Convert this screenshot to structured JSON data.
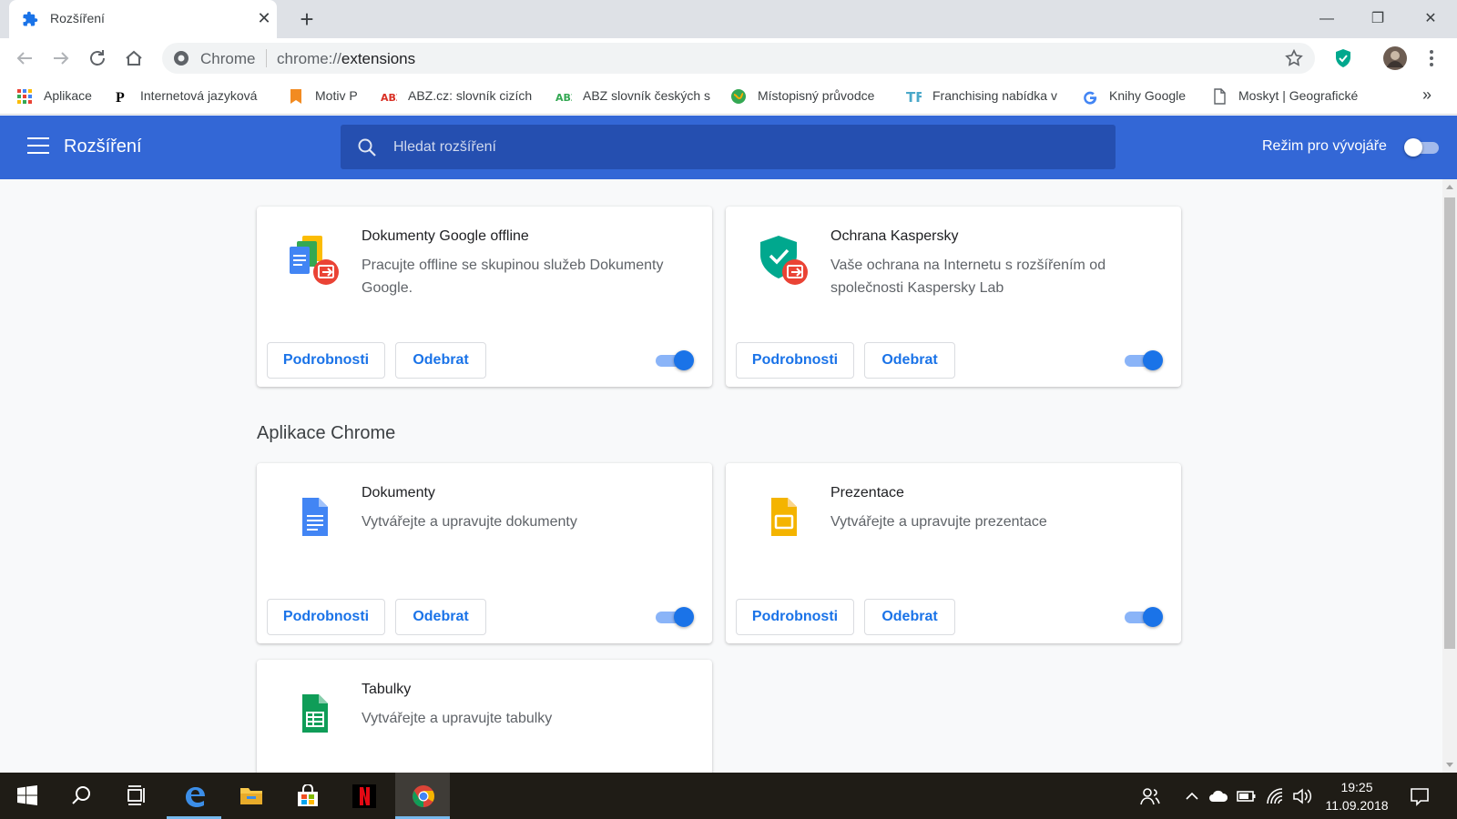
{
  "browser": {
    "tab_title": "Rozšíření",
    "new_tab_symbol": "+",
    "close_symbol": "✕",
    "window_controls": {
      "minimize": "—",
      "restore": "❐",
      "close": "✕"
    }
  },
  "omnibox": {
    "site_chip": "Chrome",
    "url_scheme": "chrome://",
    "url_host": "extensions"
  },
  "bookmarks": {
    "items": [
      {
        "label": "Aplikace",
        "icon": "apps-grid-icon"
      },
      {
        "label": "Internetová jazyková",
        "icon": "p-letter-icon"
      },
      {
        "label": "Motiv P",
        "icon": "bookmark-icon"
      },
      {
        "label": "ABZ.cz: slovník cizích",
        "icon": "abz-icon"
      },
      {
        "label": "ABZ slovník českých s",
        "icon": "abz-green-icon"
      },
      {
        "label": "Místopisný průvodce",
        "icon": "globe-icon"
      },
      {
        "label": "Franchising nabídka v",
        "icon": "tf-icon"
      },
      {
        "label": "Knihy Google",
        "icon": "google-g-icon"
      },
      {
        "label": "Moskyt | Geografické",
        "icon": "page-icon"
      }
    ],
    "more": "»"
  },
  "header": {
    "title": "Rozšíření",
    "search_placeholder": "Hledat rozšíření",
    "dev_mode_label": "Režim pro vývojáře"
  },
  "section_title": "Aplikace Chrome",
  "cards": [
    {
      "name": "Dokumenty Google offline",
      "description": "Pracujte offline se skupinou služeb Dokumenty Google.",
      "details": "Podrobnosti",
      "remove": "Odebrat"
    },
    {
      "name": "Ochrana Kaspersky",
      "description": "Vaše ochrana na Internetu s rozšířením od společnosti Kaspersky Lab",
      "details": "Podrobnosti",
      "remove": "Odebrat"
    },
    {
      "name": "Dokumenty",
      "description": "Vytvářejte a upravujte dokumenty",
      "details": "Podrobnosti",
      "remove": "Odebrat"
    },
    {
      "name": "Prezentace",
      "description": "Vytvářejte a upravujte prezentace",
      "details": "Podrobnosti",
      "remove": "Odebrat"
    },
    {
      "name": "Tabulky",
      "description": "Vytvářejte a upravujte tabulky"
    }
  ],
  "taskbar": {
    "time": "19:25",
    "date": "11.09.2018"
  },
  "colors": {
    "accent": "#3367d6",
    "search_bg": "#254fb0",
    "button_text": "#1a73e8"
  }
}
